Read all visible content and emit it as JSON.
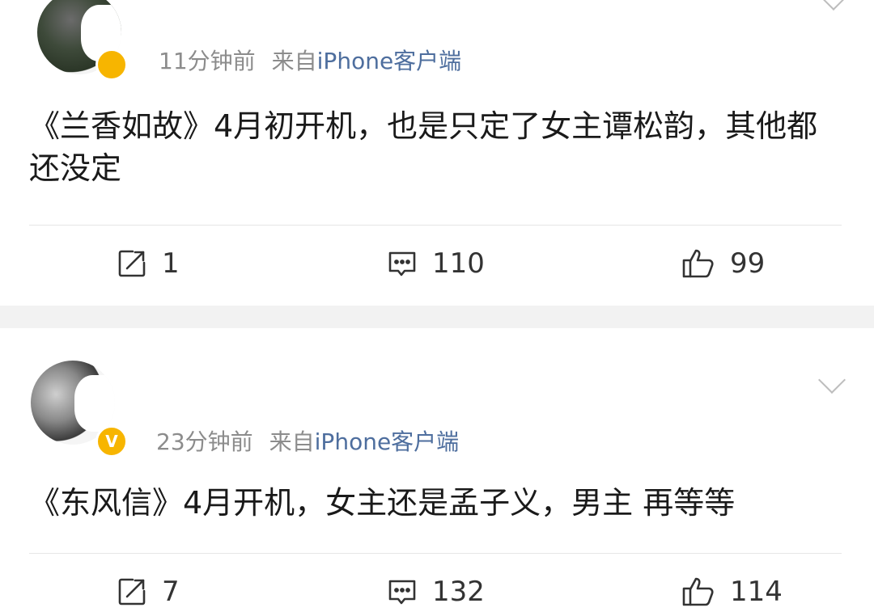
{
  "posts": [
    {
      "time": "11分钟前",
      "source_prefix": "来自",
      "client": "iPhone客户端",
      "content": "《兰香如故》4月初开机，也是只定了女主谭松韵，其他都还没定",
      "reposts": "1",
      "comments": "110",
      "likes": "99",
      "badge": "",
      "icons": {
        "repost": "share-icon",
        "comment": "comment-icon",
        "like": "thumbs-up-icon",
        "menu": "chevron-down-icon"
      }
    },
    {
      "time": "23分钟前",
      "source_prefix": "来自",
      "client": "iPhone客户端",
      "content": "《东风信》4月开机，女主还是孟子义，男主 再等等",
      "reposts": "7",
      "comments": "132",
      "likes": "114",
      "badge": "V",
      "icons": {
        "repost": "share-icon",
        "comment": "comment-icon",
        "like": "thumbs-up-icon",
        "menu": "chevron-down-icon"
      }
    }
  ],
  "colors": {
    "client_link": "#4e6e9e",
    "meta_gray": "#8c8c8c",
    "badge": "#f7b500",
    "separator": "#f2f2f2"
  }
}
